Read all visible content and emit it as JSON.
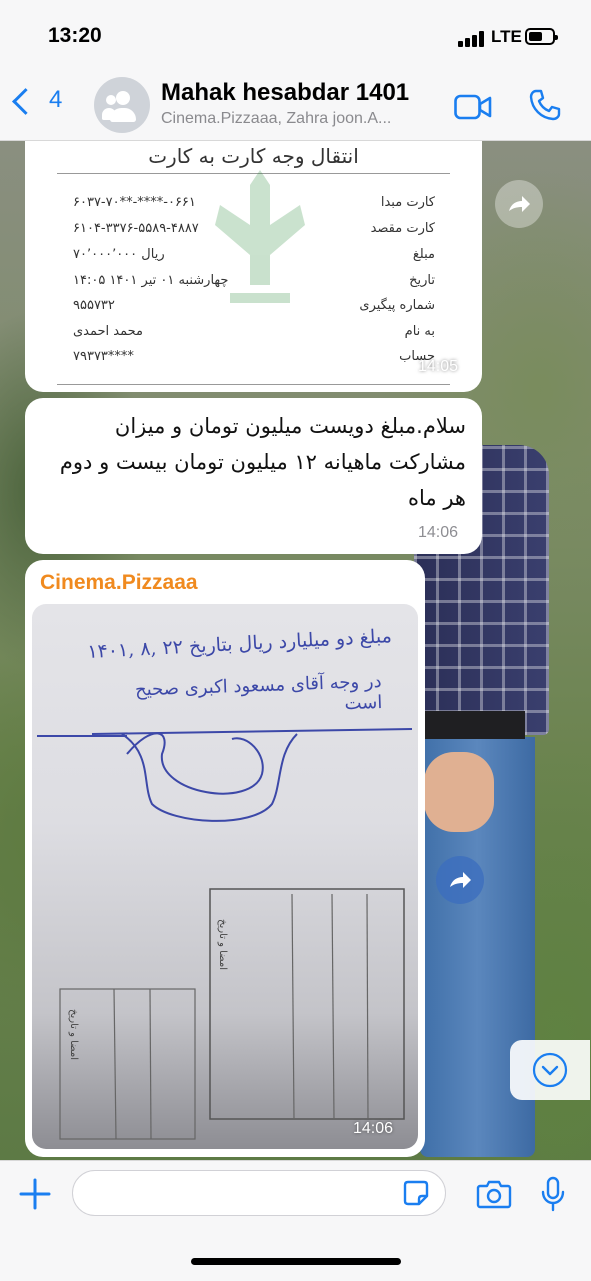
{
  "status_bar": {
    "time": "13:20",
    "network": "LTE"
  },
  "header": {
    "back_count": "4",
    "title": "Mahak hesabdar 1401",
    "subtitle": "Cinema.Pizzaaa, Zahra joon.A...",
    "icons": [
      "chevron-left-icon",
      "group-avatar-icon",
      "video-call-icon",
      "phone-icon"
    ]
  },
  "messages": [
    {
      "type": "image_receipt",
      "receipt": {
        "title": "انتقال وجه کارت به کارت",
        "rows": [
          {
            "label": "کارت مبدا",
            "value": "۶۰۳۷-۷۰**-****-۰۶۶۱"
          },
          {
            "label": "کارت مقصد",
            "value": "۶۱۰۴-۳۳۷۶-۵۵۸۹-۴۸۸۷"
          },
          {
            "label": "مبلغ",
            "value": "۷۰٬۰۰۰٬۰۰۰ ریال"
          },
          {
            "label": "تاریخ",
            "value": "چهارشنبه ۰۱ تیر ۱۴۰۱ ۱۴:۰۵"
          },
          {
            "label": "شماره پیگیری",
            "value": "۹۵۵۷۳۲"
          },
          {
            "label": "به نام",
            "value": "محمد احمدی"
          },
          {
            "label": "حساب",
            "value": "۷۹۳۷۳****"
          }
        ]
      },
      "time": "14:05"
    },
    {
      "type": "text",
      "text": "سلام.مبلغ دویست میلیون تومان و میزان مشارکت ماهیانه ۱۲ میلیون تومان بیست و دوم هر ماه",
      "time": "14:06"
    },
    {
      "type": "image_handwritten",
      "sender": "Cinema.Pizzaaa",
      "handwriting_line1": "مبلغ دو میلیارد ریال بتاریخ ۲۲ ,۸ ,۱۴۰۱",
      "handwriting_line2": "در وجه آقای مسعود اکبری صحیح است",
      "form_label_right": "امضا و تاریخ",
      "form_label_left": "امضا و تاریخ",
      "time": "14:06"
    }
  ],
  "input": {
    "placeholder": ""
  },
  "colors": {
    "accent": "#1a7ef0",
    "sender_name": "#f08a1f"
  }
}
